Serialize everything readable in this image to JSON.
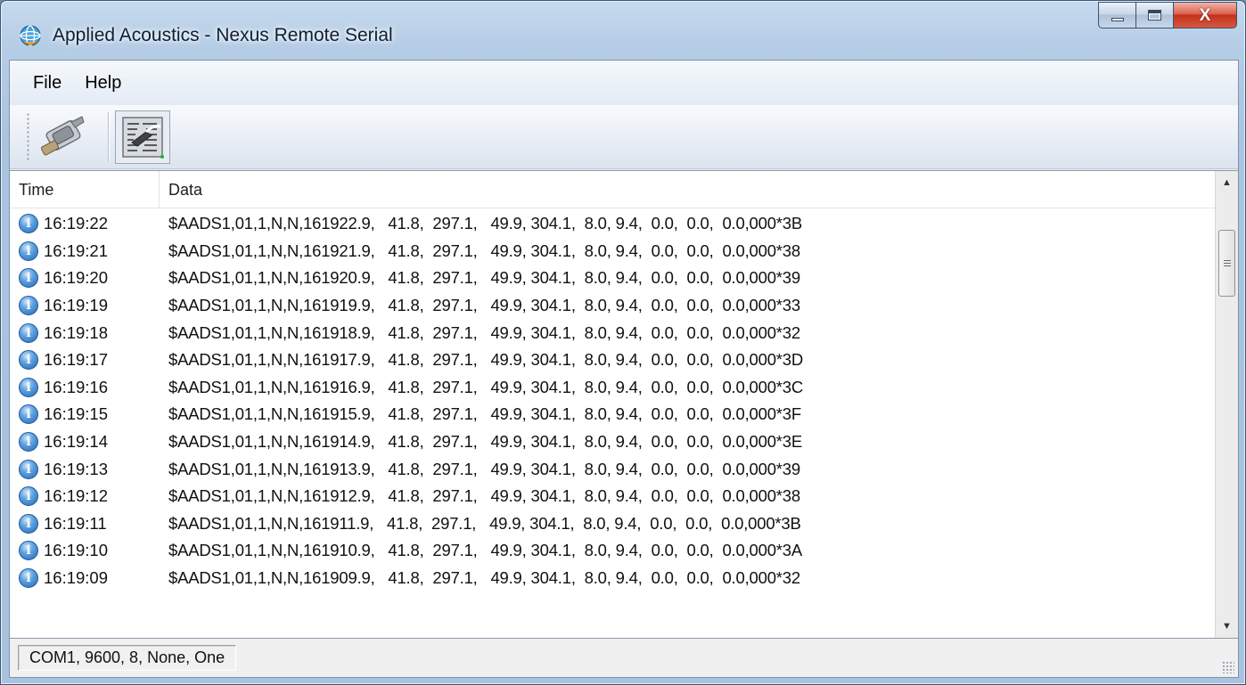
{
  "window": {
    "title": "Applied Acoustics - Nexus Remote Serial",
    "close_glyph": "X"
  },
  "menu": [
    "File",
    "Help"
  ],
  "toolbar": {
    "buttons": [
      {
        "icon": "serial-connector-icon",
        "active": false
      },
      {
        "icon": "data-log-icon",
        "active": true
      }
    ]
  },
  "list": {
    "columns": [
      "Time",
      "Data"
    ],
    "rows": [
      {
        "time": "16:19:22",
        "data": "$AADS1,01,1,N,N,161922.9,   41.8,  297.1,   49.9, 304.1,  8.0, 9.4,  0.0,  0.0,  0.0,000*3B"
      },
      {
        "time": "16:19:21",
        "data": "$AADS1,01,1,N,N,161921.9,   41.8,  297.1,   49.9, 304.1,  8.0, 9.4,  0.0,  0.0,  0.0,000*38"
      },
      {
        "time": "16:19:20",
        "data": "$AADS1,01,1,N,N,161920.9,   41.8,  297.1,   49.9, 304.1,  8.0, 9.4,  0.0,  0.0,  0.0,000*39"
      },
      {
        "time": "16:19:19",
        "data": "$AADS1,01,1,N,N,161919.9,   41.8,  297.1,   49.9, 304.1,  8.0, 9.4,  0.0,  0.0,  0.0,000*33"
      },
      {
        "time": "16:19:18",
        "data": "$AADS1,01,1,N,N,161918.9,   41.8,  297.1,   49.9, 304.1,  8.0, 9.4,  0.0,  0.0,  0.0,000*32"
      },
      {
        "time": "16:19:17",
        "data": "$AADS1,01,1,N,N,161917.9,   41.8,  297.1,   49.9, 304.1,  8.0, 9.4,  0.0,  0.0,  0.0,000*3D"
      },
      {
        "time": "16:19:16",
        "data": "$AADS1,01,1,N,N,161916.9,   41.8,  297.1,   49.9, 304.1,  8.0, 9.4,  0.0,  0.0,  0.0,000*3C"
      },
      {
        "time": "16:19:15",
        "data": "$AADS1,01,1,N,N,161915.9,   41.8,  297.1,   49.9, 304.1,  8.0, 9.4,  0.0,  0.0,  0.0,000*3F"
      },
      {
        "time": "16:19:14",
        "data": "$AADS1,01,1,N,N,161914.9,   41.8,  297.1,   49.9, 304.1,  8.0, 9.4,  0.0,  0.0,  0.0,000*3E"
      },
      {
        "time": "16:19:13",
        "data": "$AADS1,01,1,N,N,161913.9,   41.8,  297.1,   49.9, 304.1,  8.0, 9.4,  0.0,  0.0,  0.0,000*39"
      },
      {
        "time": "16:19:12",
        "data": "$AADS1,01,1,N,N,161912.9,   41.8,  297.1,   49.9, 304.1,  8.0, 9.4,  0.0,  0.0,  0.0,000*38"
      },
      {
        "time": "16:19:11",
        "data": "$AADS1,01,1,N,N,161911.9,   41.8,  297.1,   49.9, 304.1,  8.0, 9.4,  0.0,  0.0,  0.0,000*3B"
      },
      {
        "time": "16:19:10",
        "data": "$AADS1,01,1,N,N,161910.9,   41.8,  297.1,   49.9, 304.1,  8.0, 9.4,  0.0,  0.0,  0.0,000*3A"
      },
      {
        "time": "16:19:09",
        "data": "$AADS1,01,1,N,N,161909.9,   41.8,  297.1,   49.9, 304.1,  8.0, 9.4,  0.0,  0.0,  0.0,000*32"
      }
    ]
  },
  "status": {
    "port_settings": "COM1, 9600, 8, None, One"
  },
  "colors": {
    "frame": "#a9c2de",
    "close_button": "#c3321c",
    "info_icon": "#2566b4"
  }
}
